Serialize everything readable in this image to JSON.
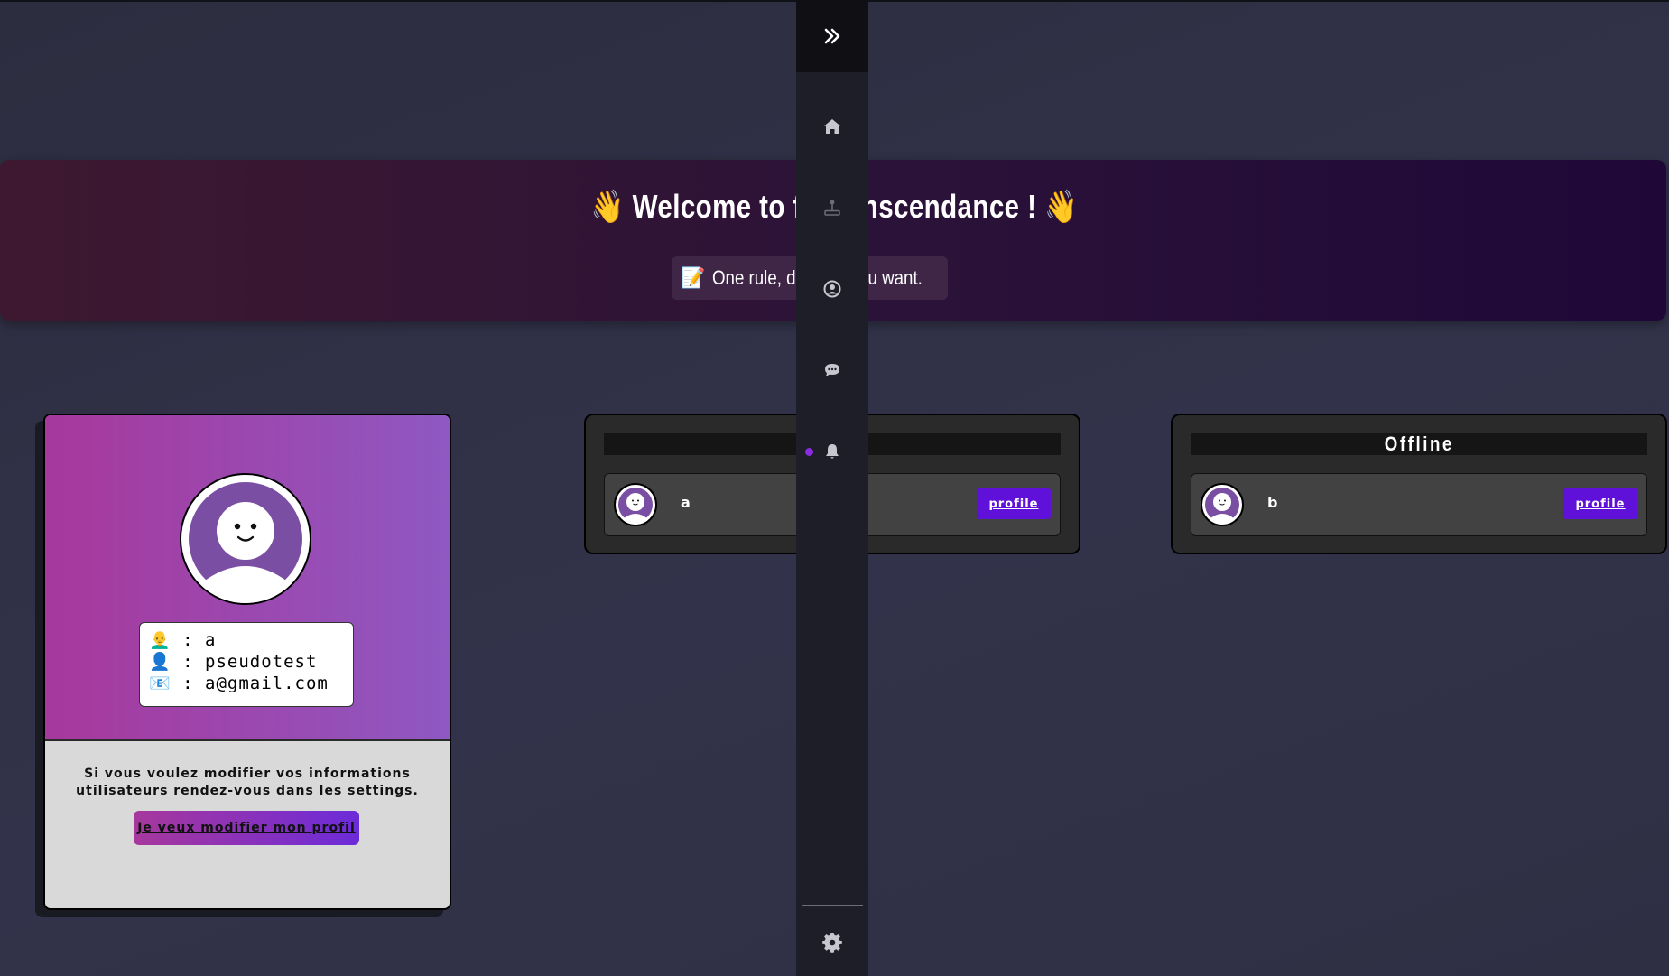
{
  "banner": {
    "title": "👋 Welcome to ft_transcendance ! 👋",
    "subtitle_emoji": "📝",
    "subtitle": "One rule, do what you want."
  },
  "sidebar": {
    "items": [
      {
        "icon": "double-chevron-right-icon"
      },
      {
        "icon": "home-icon"
      },
      {
        "icon": "joystick-icon"
      },
      {
        "icon": "user-circle-icon"
      },
      {
        "icon": "chat-icon"
      },
      {
        "icon": "bell-icon"
      },
      {
        "icon": "gear-icon"
      }
    ],
    "accent": "#8a2be2"
  },
  "profile": {
    "rows": [
      {
        "emoji": "👨‍🦲",
        "sep": ":",
        "value": "a"
      },
      {
        "emoji": "👤",
        "sep": ":",
        "value": "pseudotest"
      },
      {
        "emoji": "📧",
        "sep": ":",
        "value": "a@gmail.com"
      }
    ],
    "hint": "Si vous voulez modifier vos informations utilisateurs rendez-vous dans les settings.",
    "edit_button": "Je veux modifier mon profil"
  },
  "friends": {
    "online": {
      "title": "",
      "users": [
        {
          "name": "a",
          "button": "profile"
        }
      ]
    },
    "offline": {
      "title": "Offline",
      "users": [
        {
          "name": "b",
          "button": "profile"
        }
      ]
    }
  },
  "colors": {
    "button_purple": "#6011d9",
    "card_gradient_start": "#a7389c",
    "card_gradient_end": "#8f58c2"
  }
}
